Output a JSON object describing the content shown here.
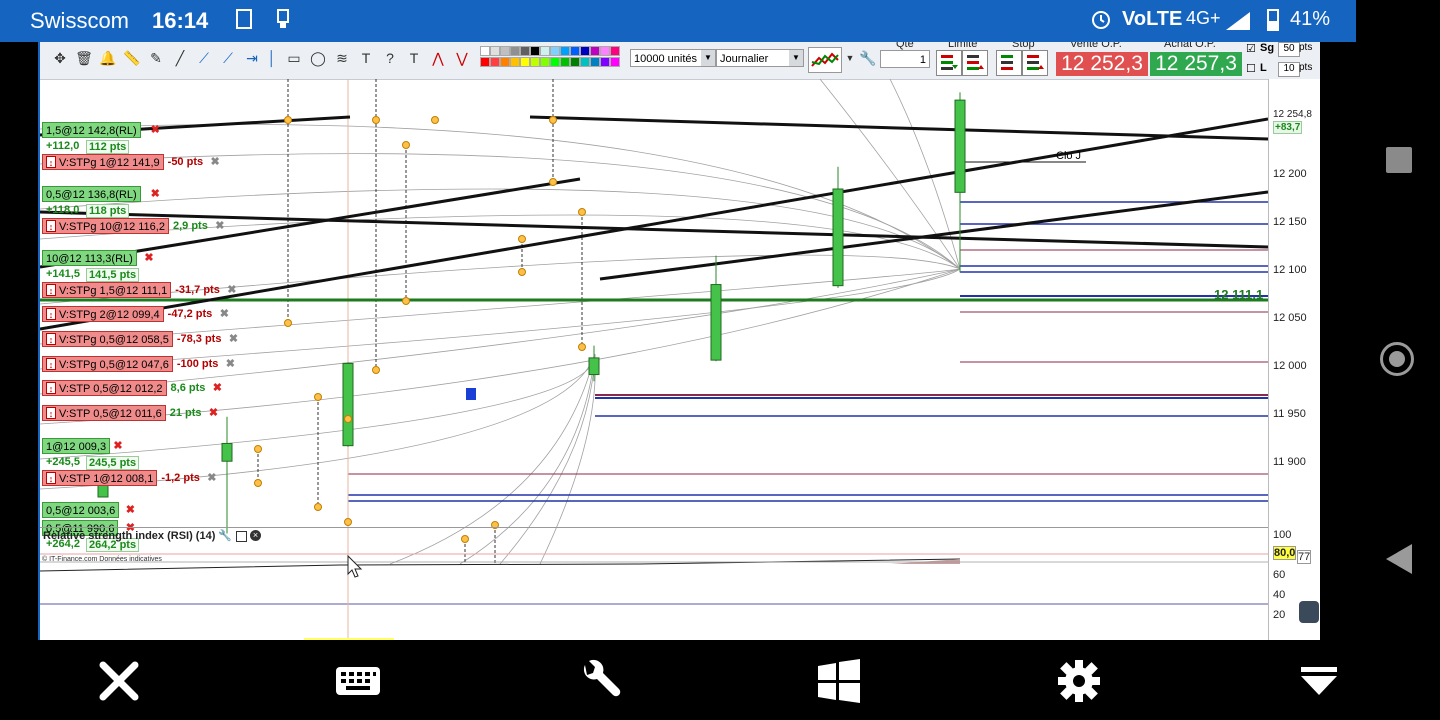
{
  "status_bar": {
    "carrier": "Swisscom",
    "time": "16:14",
    "network": "4G+",
    "battery": "41%"
  },
  "toolbar": {
    "units_select": "10000 unités",
    "period_select": "Journalier",
    "qty_label": "Qté",
    "qty_value": "1",
    "limit_label": "Limite",
    "stop_label": "Stop",
    "sell_label": "Vente O.P.",
    "buy_label": "Achat O.P.",
    "sell_price": "12 252,3",
    "buy_price": "12 257,3",
    "sg_label": "Sg",
    "l_label": "L",
    "sg_pts": "50",
    "l_pts": "10",
    "pts_unit": "pts"
  },
  "chart": {
    "clo_label": "Clo J",
    "current_level_label": "12 111,1",
    "credit": "© IT-Finance.com Données indicatives",
    "last_price_tag": "12 254,8",
    "last_change_tag": "+83,7",
    "positions": [
      {
        "kind": "green",
        "label": "1,5@12 142,8(RL)"
      },
      {
        "kind": "gain",
        "value": "+112,0",
        "pts": "112 pts"
      },
      {
        "kind": "red",
        "label": "V:STPg 1@12 141,9",
        "pts": "-50 pts"
      },
      {
        "kind": "green",
        "label": "0,5@12 136,8(RL)"
      },
      {
        "kind": "gain",
        "value": "+118,0",
        "pts": "118 pts"
      },
      {
        "kind": "red",
        "label": "V:STPg 10@12 116,2",
        "pts": "2,9 pts"
      },
      {
        "kind": "green",
        "label": "10@12 113,3(RL)"
      },
      {
        "kind": "gain",
        "value": "+141,5",
        "pts": "141,5 pts"
      },
      {
        "kind": "red",
        "label": "V:STPg 1,5@12 111,1",
        "pts": "-31,7 pts"
      },
      {
        "kind": "red",
        "label": "V:STPg 2@12 099,4",
        "pts": "-47,2 pts"
      },
      {
        "kind": "red",
        "label": "V:STPg 0,5@12 058,5",
        "pts": "-78,3 pts"
      },
      {
        "kind": "red",
        "label": "V:STPg 0,5@12 047,6",
        "pts": "-100 pts"
      },
      {
        "kind": "red",
        "label": "V:STP 0,5@12 012,2",
        "pts": "8,6 pts"
      },
      {
        "kind": "red",
        "label": "V:STP 0,5@12 011,6",
        "pts": "21 pts"
      },
      {
        "kind": "green",
        "label": "1@12 009,3"
      },
      {
        "kind": "gain",
        "value": "+245,5",
        "pts": "245,5 pts"
      },
      {
        "kind": "red",
        "label": "V:STP 1@12 008,1",
        "pts": "-1,2 pts"
      },
      {
        "kind": "green",
        "label": "0,5@12 003,6"
      },
      {
        "kind": "green",
        "label": "0,5@11 990,6"
      },
      {
        "kind": "gain",
        "value": "+264,2",
        "pts": "264,2 pts"
      }
    ],
    "axis_ticks": [
      "12 200",
      "12 150",
      "12 100",
      "12 050",
      "12 000",
      "11 950",
      "11 900"
    ],
    "rsi_title": "Relative strength index (RSI) (14)",
    "rsi_ticks": [
      "100",
      "80,0",
      "60",
      "40",
      "20"
    ],
    "rsi_value": "77"
  },
  "chart_data": {
    "type": "candlestick",
    "ylim": [
      11860,
      12265
    ],
    "candles": [
      {
        "open": 11930,
        "close": 11946,
        "high": 11970,
        "low": 11865
      },
      {
        "open": 11944,
        "close": 12018,
        "high": 12019,
        "low": 11943
      },
      {
        "open": 12008,
        "close": 12023,
        "high": 12034,
        "low": 12002
      },
      {
        "open": 12021,
        "close": 12089,
        "high": 12115,
        "low": 12020
      },
      {
        "open": 12088,
        "close": 12175,
        "high": 12195,
        "low": 12086
      },
      {
        "open": 12172,
        "close": 12255,
        "high": 12262,
        "low": 12100
      }
    ],
    "horizontal_levels": [
      12111.1,
      12142.8,
      12136.8,
      12116.2,
      12099.4,
      12058.5,
      12047.6,
      12012.2,
      12011.6,
      12009.3,
      12008.1,
      12003.6,
      11990.6
    ]
  },
  "nav": {
    "close": "close",
    "keyboard": "keyboard",
    "tools": "tools",
    "windows": "windows",
    "settings": "settings",
    "menu": "menu"
  }
}
